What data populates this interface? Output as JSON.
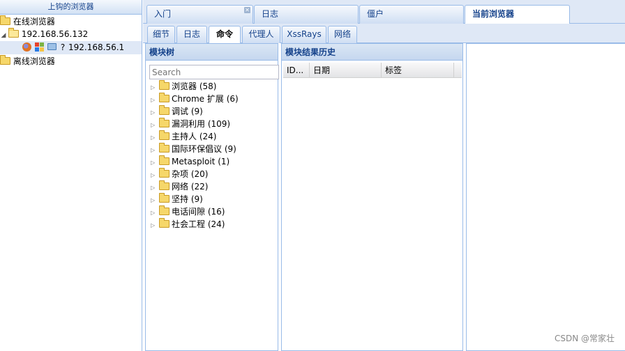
{
  "left_panel": {
    "title": "上钩的浏览器",
    "online_label": "在线浏览器",
    "host_ip": "192.168.56.132",
    "browser_ip": "192.168.56.1",
    "browser_question": "?",
    "offline_label": "离线浏览器"
  },
  "top_tabs": [
    {
      "label": "入门"
    },
    {
      "label": "日志"
    },
    {
      "label": "僵户"
    },
    {
      "label": "当前浏览器"
    }
  ],
  "sub_tabs": [
    {
      "label": "细节"
    },
    {
      "label": "日志"
    },
    {
      "label": "命令"
    },
    {
      "label": "代理人"
    },
    {
      "label": "XssRays"
    },
    {
      "label": "网络"
    }
  ],
  "module_tree": {
    "title": "模块树",
    "search_placeholder": "Search",
    "items": [
      {
        "label": "浏览器 (58)"
      },
      {
        "label": "Chrome 扩展 (6)"
      },
      {
        "label": "调试 (9)"
      },
      {
        "label": "漏洞利用 (109)"
      },
      {
        "label": "主持人 (24)"
      },
      {
        "label": "国际环保倡议 (9)"
      },
      {
        "label": "Metasploit (1)"
      },
      {
        "label": "杂项 (20)"
      },
      {
        "label": "网络 (22)"
      },
      {
        "label": "坚持 (9)"
      },
      {
        "label": "电话间隙 (16)"
      },
      {
        "label": "社会工程 (24)"
      }
    ]
  },
  "results": {
    "title": "模块结果历史",
    "columns": [
      "ID...",
      "日期",
      "标签"
    ]
  },
  "watermark": "CSDN @常家壮",
  "colors": {
    "accent": "#15428b",
    "border": "#99bbe8",
    "tab_bg": "#dfe8f6"
  }
}
